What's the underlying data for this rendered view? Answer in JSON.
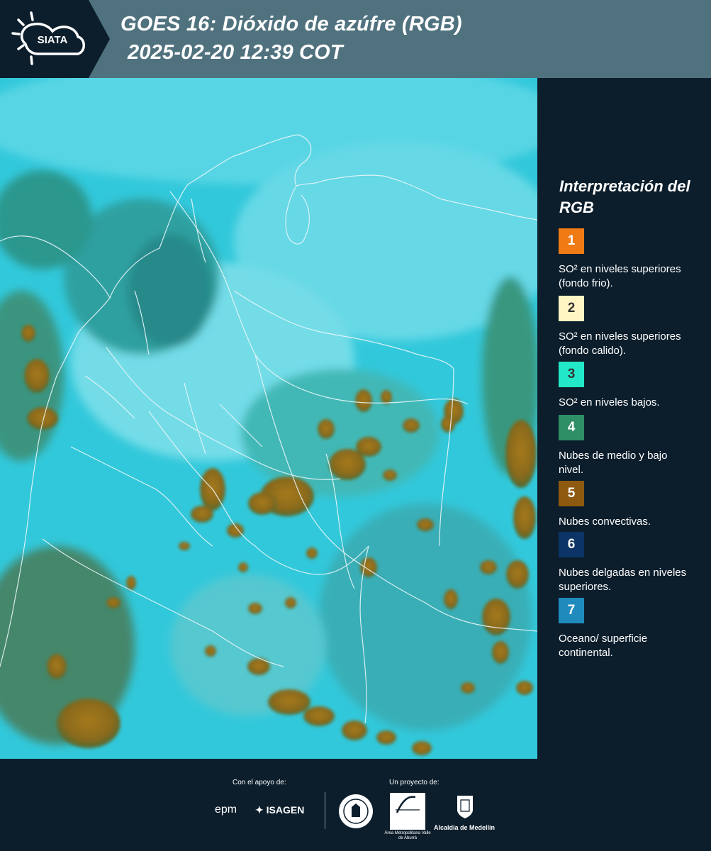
{
  "header": {
    "logo_text": "SIATA",
    "title_line1": "GOES 16: Dióxido de azúfre (RGB)",
    "title_line2": "2025-02-20 12:39 COT"
  },
  "legend": {
    "title": "Interpretación del RGB",
    "items": [
      {
        "number": "1",
        "color": "#f07a14",
        "label": "SO² en niveles superiores (fondo frio)."
      },
      {
        "number": "2",
        "color": "#fff6c4",
        "label": "SO² en niveles superiores (fondo calido)."
      },
      {
        "number": "3",
        "color": "#22e8c8",
        "label": "SO² en niveles bajos."
      },
      {
        "number": "4",
        "color": "#2e8f66",
        "label": "Nubes de medio y bajo nivel."
      },
      {
        "number": "5",
        "color": "#8e5a10",
        "label": "Nubes convectivas."
      },
      {
        "number": "6",
        "color": "#0d3466",
        "label": "Nubes delgadas en niveles superiores."
      },
      {
        "number": "7",
        "color": "#1f8bbd",
        "label": "Oceano/ superficie continental."
      }
    ]
  },
  "footer": {
    "support_label": "Con el apoyo de:",
    "project_label": "Un proyecto de:",
    "sponsors": [
      "epm",
      "ISAGEN"
    ],
    "partners": [
      "Área Metropolitana Valle de Aburrá",
      "Alcaldía de Medellín"
    ]
  }
}
